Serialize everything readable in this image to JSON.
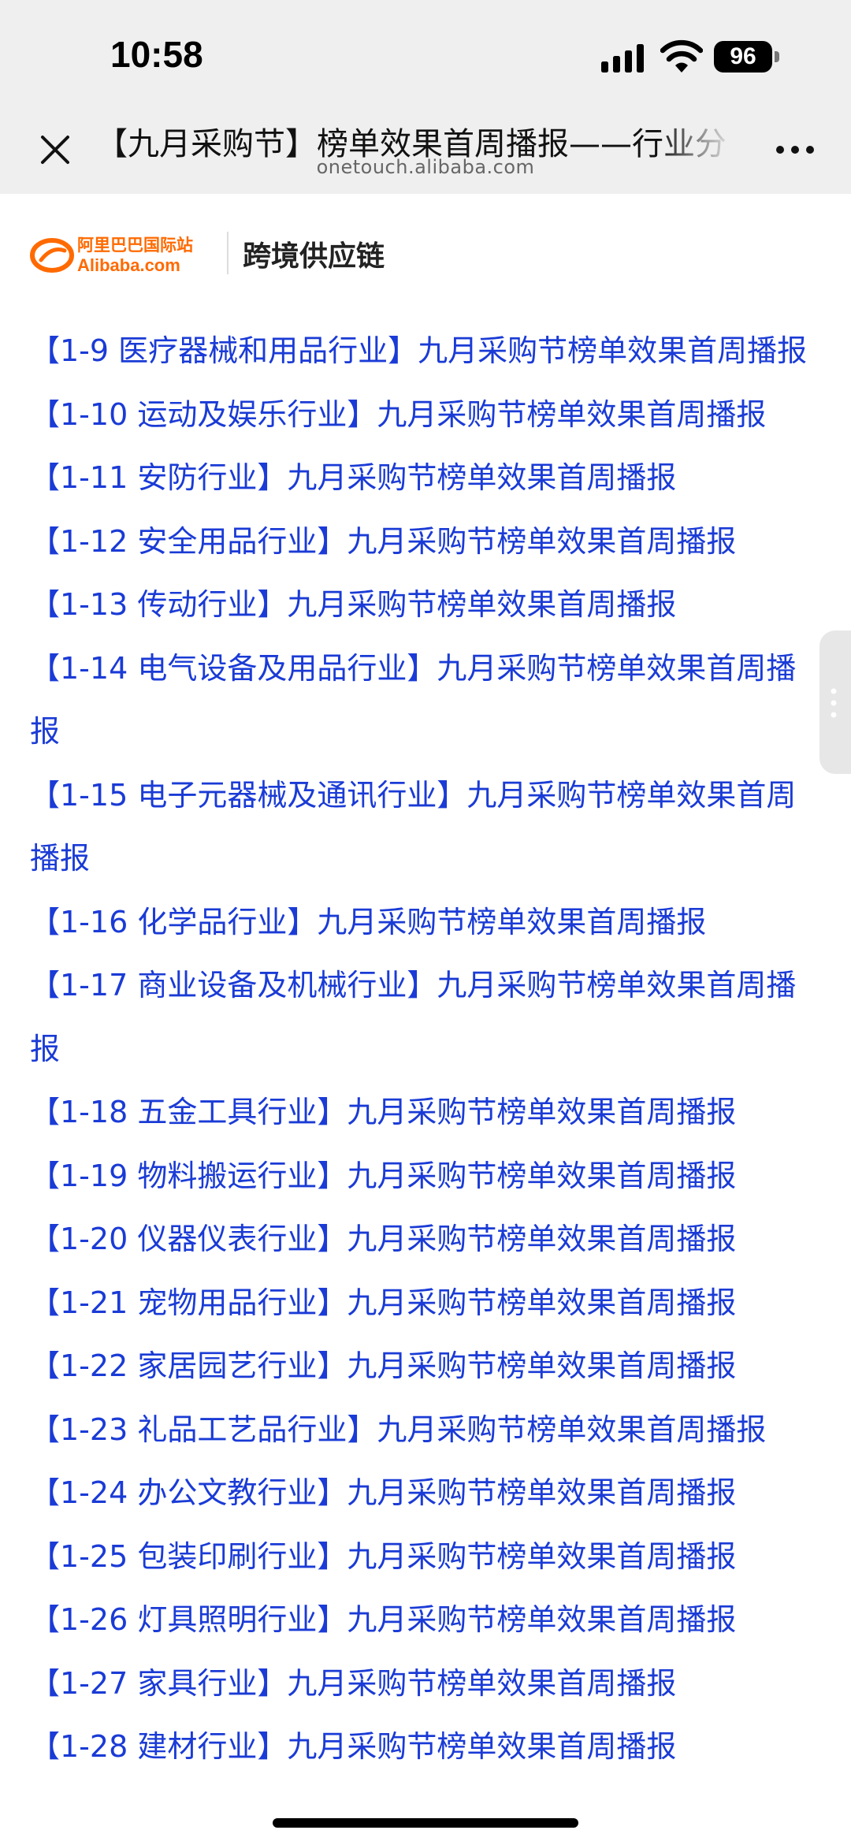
{
  "status_bar": {
    "time": "10:58",
    "battery_level": "96"
  },
  "browser": {
    "title": "【九月采购节】榜单效果首周播报——行业分",
    "url": "onetouch.alibaba.com",
    "icons": {
      "close": "close-icon",
      "more": "more-icon"
    }
  },
  "site_header": {
    "logo_cn": "阿里巴巴国际站",
    "logo_en": "Alibaba.com",
    "subtitle": "跨境供应链"
  },
  "articles": [
    "【1-9 医疗器械和用品行业】九月采购节榜单效果首周播报",
    "【1-10 运动及娱乐行业】九月采购节榜单效果首周播报",
    "【1-11 安防行业】九月采购节榜单效果首周播报",
    "【1-12 安全用品行业】九月采购节榜单效果首周播报",
    "【1-13 传动行业】九月采购节榜单效果首周播报",
    "【1-14 电气设备及用品行业】九月采购节榜单效果首周播报",
    "【1-15 电子元器械及通讯行业】九月采购节榜单效果首周播报",
    "【1-16 化学品行业】九月采购节榜单效果首周播报",
    "【1-17 商业设备及机械行业】九月采购节榜单效果首周播报",
    "【1-18 五金工具行业】九月采购节榜单效果首周播报",
    "【1-19 物料搬运行业】九月采购节榜单效果首周播报",
    "【1-20 仪器仪表行业】九月采购节榜单效果首周播报",
    "【1-21 宠物用品行业】九月采购节榜单效果首周播报",
    "【1-22 家居园艺行业】九月采购节榜单效果首周播报",
    "【1-23 礼品工艺品行业】九月采购节榜单效果首周播报",
    "【1-24 办公文教行业】九月采购节榜单效果首周播报",
    "【1-25 包装印刷行业】九月采购节榜单效果首周播报",
    "【1-26 灯具照明行业】九月采购节榜单效果首周播报",
    "【1-27 家具行业】九月采购节榜单效果首周播报",
    "【1-28 建材行业】九月采购节榜单效果首周播报"
  ],
  "colors": {
    "link": "#1a3bd6",
    "header_bg": "#efefef",
    "brand_orange": "#ff6a00"
  }
}
